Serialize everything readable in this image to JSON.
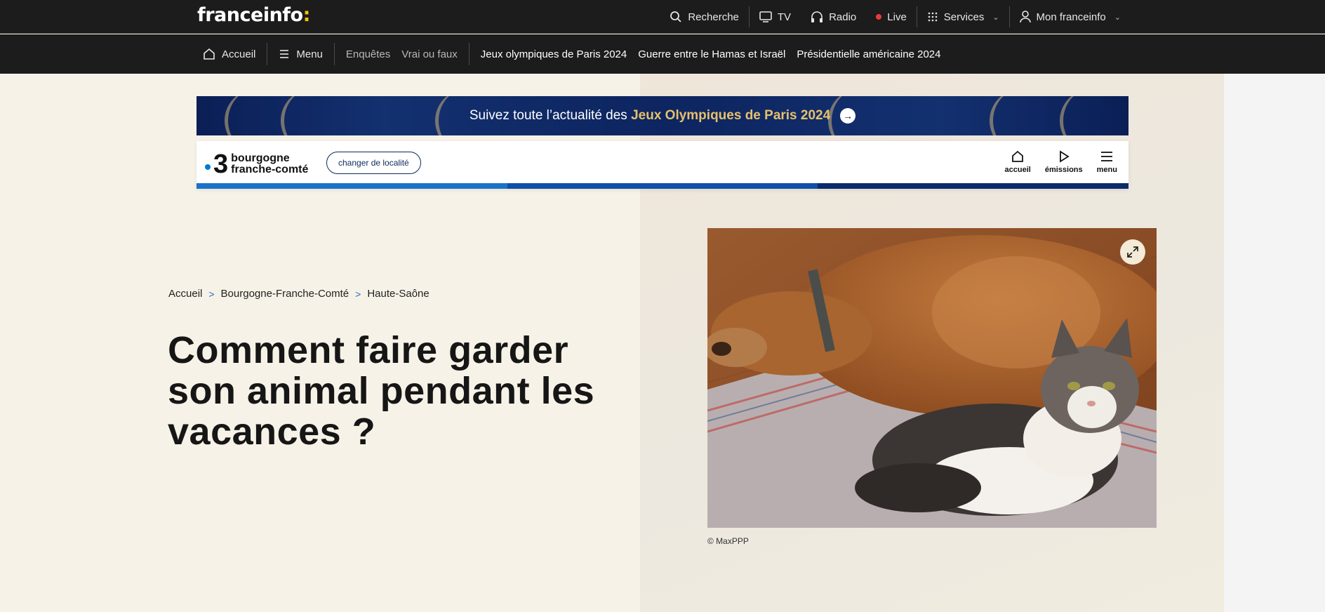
{
  "topbar": {
    "logo_text": "franceinfo",
    "logo_dot": ":",
    "search_label": "Recherche",
    "tv_label": "TV",
    "radio_label": "Radio",
    "live_label": "Live",
    "services_label": "Services",
    "account_label": "Mon franceinfo"
  },
  "subnav": {
    "home_label": "Accueil",
    "menu_label": "Menu",
    "items": [
      "Enquêtes",
      "Vrai ou faux"
    ],
    "topics": [
      "Jeux olympiques de Paris 2024",
      "Guerre entre le Hamas et Israël",
      "Présidentielle américaine 2024"
    ]
  },
  "banner": {
    "text": "Suivez toute l’actualité des ",
    "highlight": "Jeux Olympiques de Paris 2024",
    "highlight_color": "#e7c06a"
  },
  "regional": {
    "channel_number": "3",
    "region_line1": "bourgogne",
    "region_line2": "franche-comté",
    "change_location": "changer de localité",
    "nav": [
      "accueil",
      "émissions",
      "menu"
    ],
    "bar_colors": [
      "#1a73c9",
      "#0f4fa8",
      "#0b2b6a"
    ]
  },
  "breadcrumb": [
    "Accueil",
    "Bourgogne-Franche-Comté",
    "Haute-Saône"
  ],
  "article": {
    "title": "Comment faire garder son animal pendant les vacances ?",
    "photo_credit": "© MaxPPP"
  },
  "icons": [
    "search-icon",
    "tv-icon",
    "headphones-icon",
    "live-dot-icon",
    "grid-icon",
    "user-icon",
    "home-icon",
    "hamburger-icon",
    "arrow-right-icon",
    "play-icon",
    "expand-icon"
  ]
}
